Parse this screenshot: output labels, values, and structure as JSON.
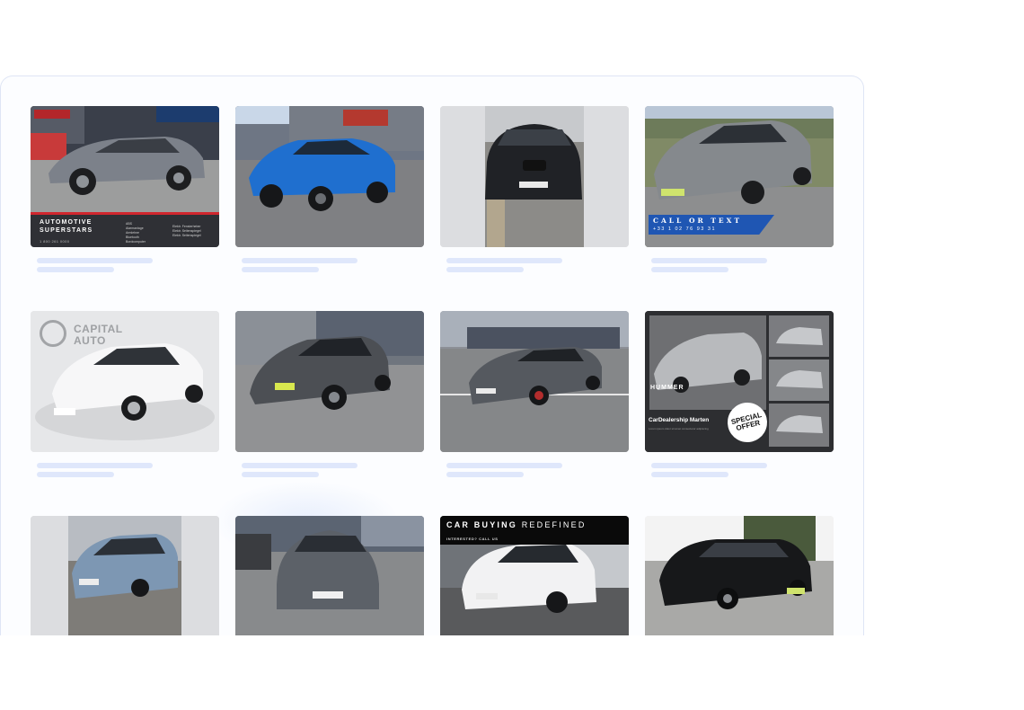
{
  "listings": [
    {
      "name": "listing-1",
      "car": "grey crossover",
      "overlay": {
        "headline": "AUTOMOTIVE SUPERSTARS",
        "phone": "1 800 261 0000",
        "features_left": [
          "ABS",
          "Alarmanlage",
          "Armlehne",
          "Bluetooth",
          "Bordcomputer"
        ],
        "features_right": [
          "Elektr. Fensterheber",
          "Elektr. Seitenspiegel",
          "Elektr. Seitenspiegel"
        ]
      }
    },
    {
      "name": "listing-2",
      "car": "blue SUV"
    },
    {
      "name": "listing-3",
      "car": "black BMW SUV"
    },
    {
      "name": "listing-4",
      "car": "grey Renault Captur",
      "overlay": {
        "cta": "CALL OR TEXT",
        "phone": "+33 1 02 76 93 31"
      }
    },
    {
      "name": "listing-5",
      "car": "white Renault Scenic",
      "overlay": {
        "watermark": [
          "CAPITAL",
          "AUTO"
        ]
      }
    },
    {
      "name": "listing-6",
      "car": "grey Alfa Romeo Stelvio"
    },
    {
      "name": "listing-7",
      "car": "grey Audi sedan"
    },
    {
      "name": "listing-8",
      "car": "silver Audi hatchback",
      "overlay": {
        "brand": "HUMMER",
        "dealer": "CarDealership Marten",
        "badge": [
          "SPECIAL",
          "OFFER"
        ]
      }
    },
    {
      "name": "listing-9",
      "car": "blue Renault crossover"
    },
    {
      "name": "listing-10",
      "car": "grey Renault SUV"
    },
    {
      "name": "listing-11",
      "car": "white BMW X4",
      "overlay": {
        "title_bold": "CAR BUYING",
        "title_light": "REDEFINED",
        "subtitle": "INTERESTED? CALL US"
      }
    },
    {
      "name": "listing-12",
      "car": "black BMW MPV"
    }
  ],
  "colors": {
    "skeleton": "#dfe7fb",
    "panel_border": "#dfe5f5",
    "call_blue": "#1f56b3",
    "banner_red": "#d0262e"
  }
}
